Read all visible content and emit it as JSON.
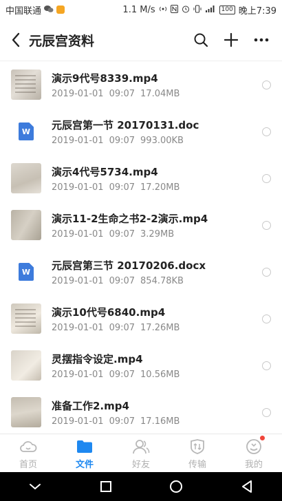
{
  "status_bar": {
    "carrier": "中国联通",
    "speed": "1.1 M/s",
    "battery": "100",
    "time": "晚上7:39"
  },
  "header": {
    "title": "元辰宫资料"
  },
  "files": [
    {
      "name": "演示9代号8339.mp4",
      "date": "2019-01-01",
      "time": "09:07",
      "size": "17.04MB",
      "kind": "video"
    },
    {
      "name": "元辰宫第一节 20170131.doc",
      "date": "2019-01-01",
      "time": "09:07",
      "size": "993.00KB",
      "kind": "doc"
    },
    {
      "name": "演示4代号5734.mp4",
      "date": "2019-01-01",
      "time": "09:07",
      "size": "17.20MB",
      "kind": "video"
    },
    {
      "name": "演示11-2生命之书2-2演示.mp4",
      "date": "2019-01-01",
      "time": "09:07",
      "size": "3.29MB",
      "kind": "video"
    },
    {
      "name": "元辰宫第三节 20170206.docx",
      "date": "2019-01-01",
      "time": "09:07",
      "size": "854.78KB",
      "kind": "doc"
    },
    {
      "name": "演示10代号6840.mp4",
      "date": "2019-01-01",
      "time": "09:07",
      "size": "17.26MB",
      "kind": "video"
    },
    {
      "name": "灵摆指令设定.mp4",
      "date": "2019-01-01",
      "time": "09:07",
      "size": "10.56MB",
      "kind": "video"
    },
    {
      "name": "准备工作2.mp4",
      "date": "2019-01-01",
      "time": "09:07",
      "size": "17.16MB",
      "kind": "video"
    }
  ],
  "doc_icon_letter": "W",
  "tabs": [
    {
      "label": "首页",
      "icon": "cloud-icon"
    },
    {
      "label": "文件",
      "icon": "folder-icon",
      "active": true
    },
    {
      "label": "好友",
      "icon": "friends-icon"
    },
    {
      "label": "传输",
      "icon": "transfer-icon"
    },
    {
      "label": "我的",
      "icon": "profile-icon"
    }
  ],
  "colors": {
    "accent": "#1e88f0",
    "doc_blue": "#3d7bdc",
    "notification": "#f0453a"
  }
}
